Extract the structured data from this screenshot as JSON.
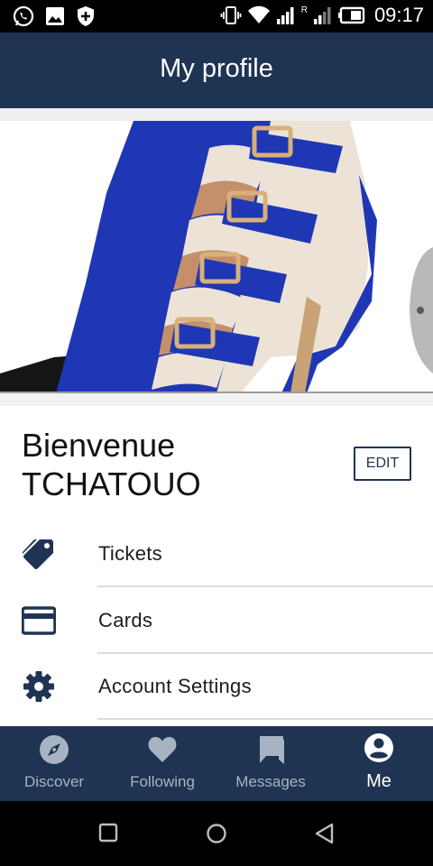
{
  "status_bar": {
    "time": "09:17",
    "left_icons": [
      "whatsapp-icon",
      "gallery-icon",
      "shield-plus-icon"
    ],
    "right_icons": [
      "vibrate-icon",
      "wifi-icon",
      "signal-icon",
      "roaming-r-icon",
      "signal-icon",
      "battery-icon"
    ],
    "roaming_label": "R"
  },
  "header": {
    "title": "My profile"
  },
  "hero": {
    "image": "blue-cream-buckle-heel-shoe-photo"
  },
  "profile": {
    "greeting_line1": "Bienvenue",
    "greeting_line2": "TCHATOUO",
    "edit_label": "EDIT"
  },
  "menu": {
    "items": [
      {
        "label": "Tickets",
        "icon": "tag-icon"
      },
      {
        "label": "Cards",
        "icon": "credit-card-icon"
      },
      {
        "label": "Account Settings",
        "icon": "gear-icon"
      }
    ]
  },
  "bottom_nav": {
    "items": [
      {
        "label": "Discover",
        "icon": "compass-icon",
        "active": false
      },
      {
        "label": "Following",
        "icon": "heart-icon",
        "active": false
      },
      {
        "label": "Messages",
        "icon": "chat-bubbles-icon",
        "active": false
      },
      {
        "label": "Me",
        "icon": "account-circle-icon",
        "active": true
      }
    ]
  },
  "system_nav": [
    "recents-square-icon",
    "home-circle-icon",
    "back-triangle-icon"
  ],
  "colors": {
    "primary": "#1f3452",
    "inactive_nav_label": "#a7b3c2",
    "shoe_blue": "#1f37b4",
    "shoe_cream": "#ece3d6"
  }
}
